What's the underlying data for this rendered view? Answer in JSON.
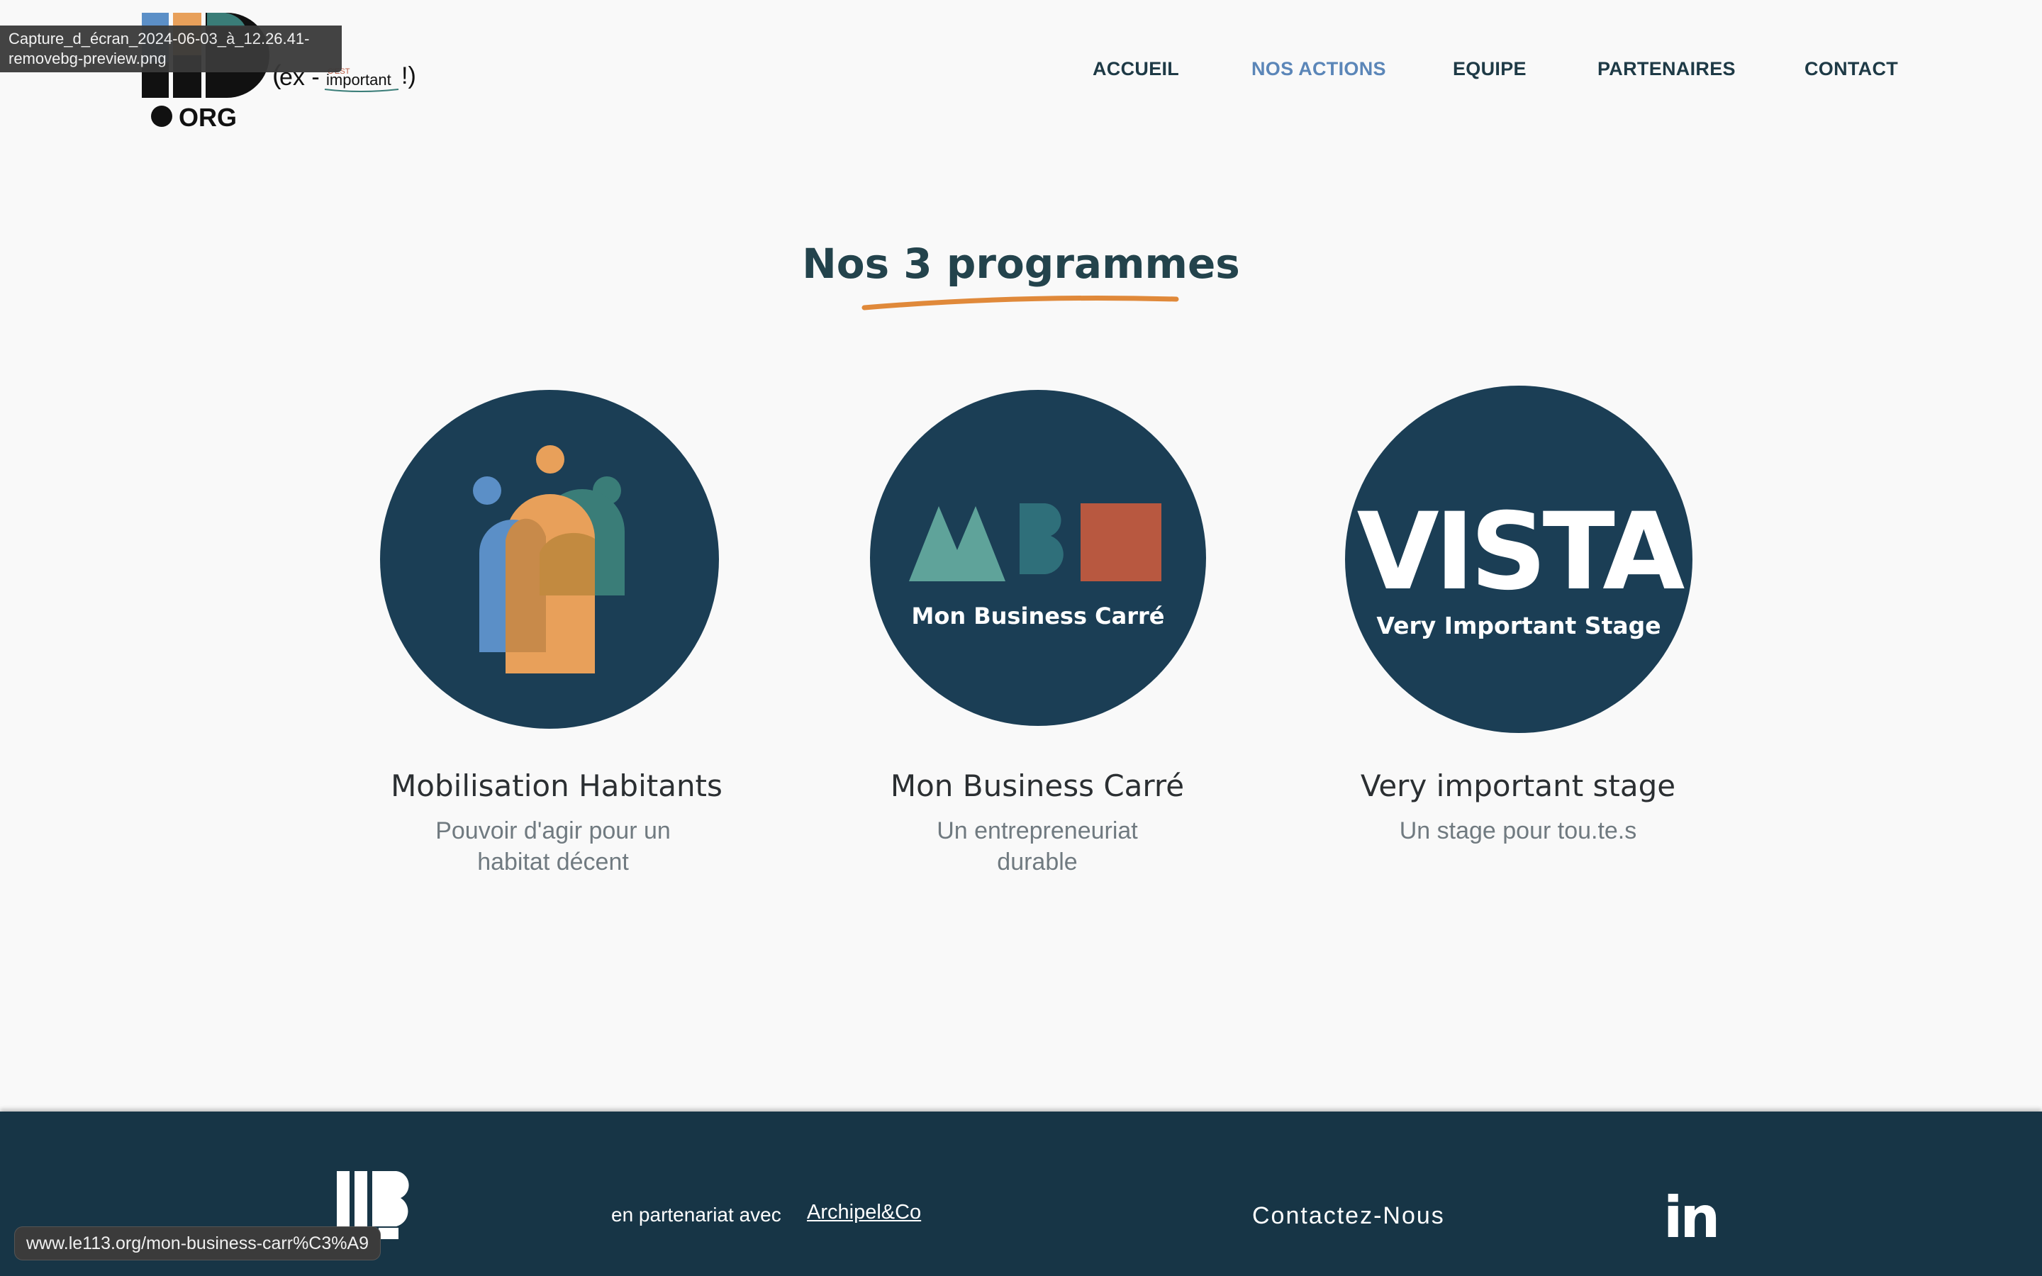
{
  "header": {
    "logo_number": "113",
    "logo_org": "ORG",
    "logo_ex": "ex -",
    "logo_important": "important",
    "logo_cest": "C'EST",
    "nav": [
      {
        "label": "ACCUEIL",
        "active": false
      },
      {
        "label": "NOS ACTIONS",
        "active": true
      },
      {
        "label": "EQUIPE",
        "active": false
      },
      {
        "label": "PARTENAIRES",
        "active": false
      },
      {
        "label": "CONTACT",
        "active": false
      }
    ]
  },
  "tooltip": {
    "line1": "Capture_d_écran_2024-06-03_à_12.26.41-",
    "line2": "removebg-preview.png"
  },
  "section": {
    "title": "Nos 3 programmes",
    "accent_color": "#e0893a"
  },
  "programs": [
    {
      "title": "Mobilisation Habitants",
      "desc_line1": "Pouvoir d'agir pour un",
      "desc_line2": "habitat décent",
      "icon": "people-icon"
    },
    {
      "title": "Mon Business Carré",
      "desc_line1": "Un entrepreneuriat",
      "desc_line2": "durable",
      "logo_caption": "Mon Business Carré",
      "icon": "mbc-logo"
    },
    {
      "title": "Very important stage",
      "desc_line1": "Un stage pour tou.te.s",
      "desc_line2": "",
      "logo_word": "VISTA",
      "logo_caption": "Very Important Stage",
      "icon": "vista-logo"
    }
  ],
  "footer": {
    "logo_number": "113",
    "partner_text": "en partenariat avec",
    "partner_link": "Archipel&Co",
    "contact": "Contactez-Nous",
    "social": "in"
  },
  "status_bar": {
    "url": "www.le113.org/mon-business-carr%C3%A9"
  },
  "colors": {
    "navy": "#1b3e55",
    "footer": "#173546",
    "orange": "#e8a05a",
    "teal": "#3a7d78",
    "blue": "#5b8fc7",
    "rust": "#b85840"
  }
}
